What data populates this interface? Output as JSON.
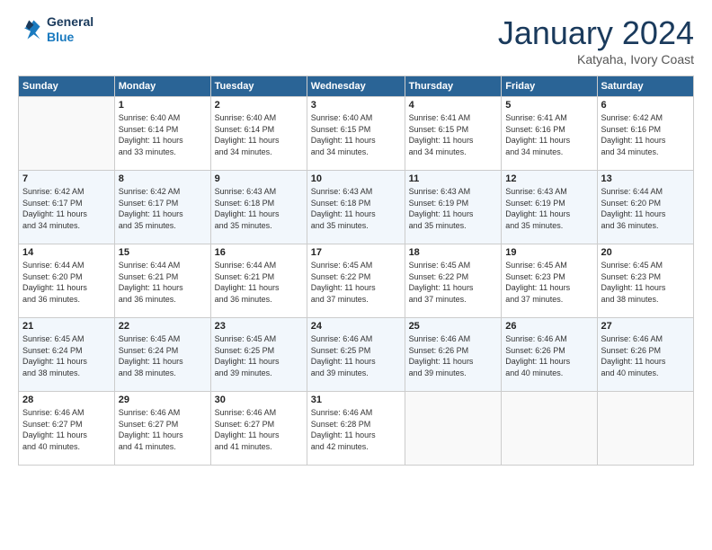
{
  "logo": {
    "line1": "General",
    "line2": "Blue"
  },
  "header": {
    "month": "January 2024",
    "location": "Katyaha, Ivory Coast"
  },
  "weekdays": [
    "Sunday",
    "Monday",
    "Tuesday",
    "Wednesday",
    "Thursday",
    "Friday",
    "Saturday"
  ],
  "weeks": [
    [
      {
        "day": "",
        "info": ""
      },
      {
        "day": "1",
        "info": "Sunrise: 6:40 AM\nSunset: 6:14 PM\nDaylight: 11 hours\nand 33 minutes."
      },
      {
        "day": "2",
        "info": "Sunrise: 6:40 AM\nSunset: 6:14 PM\nDaylight: 11 hours\nand 34 minutes."
      },
      {
        "day": "3",
        "info": "Sunrise: 6:40 AM\nSunset: 6:15 PM\nDaylight: 11 hours\nand 34 minutes."
      },
      {
        "day": "4",
        "info": "Sunrise: 6:41 AM\nSunset: 6:15 PM\nDaylight: 11 hours\nand 34 minutes."
      },
      {
        "day": "5",
        "info": "Sunrise: 6:41 AM\nSunset: 6:16 PM\nDaylight: 11 hours\nand 34 minutes."
      },
      {
        "day": "6",
        "info": "Sunrise: 6:42 AM\nSunset: 6:16 PM\nDaylight: 11 hours\nand 34 minutes."
      }
    ],
    [
      {
        "day": "7",
        "info": "Sunrise: 6:42 AM\nSunset: 6:17 PM\nDaylight: 11 hours\nand 34 minutes."
      },
      {
        "day": "8",
        "info": "Sunrise: 6:42 AM\nSunset: 6:17 PM\nDaylight: 11 hours\nand 35 minutes."
      },
      {
        "day": "9",
        "info": "Sunrise: 6:43 AM\nSunset: 6:18 PM\nDaylight: 11 hours\nand 35 minutes."
      },
      {
        "day": "10",
        "info": "Sunrise: 6:43 AM\nSunset: 6:18 PM\nDaylight: 11 hours\nand 35 minutes."
      },
      {
        "day": "11",
        "info": "Sunrise: 6:43 AM\nSunset: 6:19 PM\nDaylight: 11 hours\nand 35 minutes."
      },
      {
        "day": "12",
        "info": "Sunrise: 6:43 AM\nSunset: 6:19 PM\nDaylight: 11 hours\nand 35 minutes."
      },
      {
        "day": "13",
        "info": "Sunrise: 6:44 AM\nSunset: 6:20 PM\nDaylight: 11 hours\nand 36 minutes."
      }
    ],
    [
      {
        "day": "14",
        "info": "Sunrise: 6:44 AM\nSunset: 6:20 PM\nDaylight: 11 hours\nand 36 minutes."
      },
      {
        "day": "15",
        "info": "Sunrise: 6:44 AM\nSunset: 6:21 PM\nDaylight: 11 hours\nand 36 minutes."
      },
      {
        "day": "16",
        "info": "Sunrise: 6:44 AM\nSunset: 6:21 PM\nDaylight: 11 hours\nand 36 minutes."
      },
      {
        "day": "17",
        "info": "Sunrise: 6:45 AM\nSunset: 6:22 PM\nDaylight: 11 hours\nand 37 minutes."
      },
      {
        "day": "18",
        "info": "Sunrise: 6:45 AM\nSunset: 6:22 PM\nDaylight: 11 hours\nand 37 minutes."
      },
      {
        "day": "19",
        "info": "Sunrise: 6:45 AM\nSunset: 6:23 PM\nDaylight: 11 hours\nand 37 minutes."
      },
      {
        "day": "20",
        "info": "Sunrise: 6:45 AM\nSunset: 6:23 PM\nDaylight: 11 hours\nand 38 minutes."
      }
    ],
    [
      {
        "day": "21",
        "info": "Sunrise: 6:45 AM\nSunset: 6:24 PM\nDaylight: 11 hours\nand 38 minutes."
      },
      {
        "day": "22",
        "info": "Sunrise: 6:45 AM\nSunset: 6:24 PM\nDaylight: 11 hours\nand 38 minutes."
      },
      {
        "day": "23",
        "info": "Sunrise: 6:45 AM\nSunset: 6:25 PM\nDaylight: 11 hours\nand 39 minutes."
      },
      {
        "day": "24",
        "info": "Sunrise: 6:46 AM\nSunset: 6:25 PM\nDaylight: 11 hours\nand 39 minutes."
      },
      {
        "day": "25",
        "info": "Sunrise: 6:46 AM\nSunset: 6:26 PM\nDaylight: 11 hours\nand 39 minutes."
      },
      {
        "day": "26",
        "info": "Sunrise: 6:46 AM\nSunset: 6:26 PM\nDaylight: 11 hours\nand 40 minutes."
      },
      {
        "day": "27",
        "info": "Sunrise: 6:46 AM\nSunset: 6:26 PM\nDaylight: 11 hours\nand 40 minutes."
      }
    ],
    [
      {
        "day": "28",
        "info": "Sunrise: 6:46 AM\nSunset: 6:27 PM\nDaylight: 11 hours\nand 40 minutes."
      },
      {
        "day": "29",
        "info": "Sunrise: 6:46 AM\nSunset: 6:27 PM\nDaylight: 11 hours\nand 41 minutes."
      },
      {
        "day": "30",
        "info": "Sunrise: 6:46 AM\nSunset: 6:27 PM\nDaylight: 11 hours\nand 41 minutes."
      },
      {
        "day": "31",
        "info": "Sunrise: 6:46 AM\nSunset: 6:28 PM\nDaylight: 11 hours\nand 42 minutes."
      },
      {
        "day": "",
        "info": ""
      },
      {
        "day": "",
        "info": ""
      },
      {
        "day": "",
        "info": ""
      }
    ]
  ]
}
